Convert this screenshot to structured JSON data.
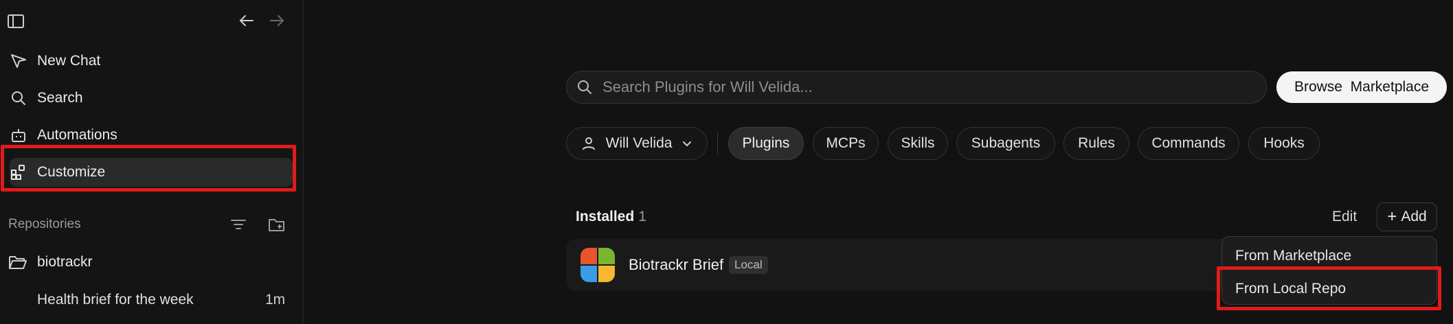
{
  "sidebar": {
    "nav": [
      {
        "label": "New Chat",
        "icon": "send-icon"
      },
      {
        "label": "Search",
        "icon": "search-icon"
      },
      {
        "label": "Automations",
        "icon": "robot-icon"
      },
      {
        "label": "Customize",
        "icon": "grid-plus-icon",
        "active": true
      }
    ],
    "repositories_label": "Repositories",
    "repo": {
      "name": "biotrackr"
    },
    "chat": {
      "title": "Health brief for the week",
      "time": "1m"
    }
  },
  "main": {
    "search": {
      "placeholder": "Search Plugins for Will Velida..."
    },
    "browse_label": "Browse  Marketplace",
    "scope": {
      "label": "Will Velida"
    },
    "tabs": [
      "Plugins",
      "MCPs",
      "Skills",
      "Subagents",
      "Rules",
      "Commands",
      "Hooks"
    ],
    "active_tab": "Plugins",
    "installed": {
      "title": "Installed",
      "count": "1"
    },
    "edit_label": "Edit",
    "add_label": "Add",
    "plugin": {
      "name": "Biotrackr Brief",
      "badge": "Local"
    },
    "add_menu": [
      "From Marketplace",
      "From Local Repo"
    ]
  },
  "colors": {
    "highlight": "#e11b1b",
    "logo": [
      "#e8542c",
      "#7ab52d",
      "#3a9be6",
      "#f5b82e"
    ]
  }
}
